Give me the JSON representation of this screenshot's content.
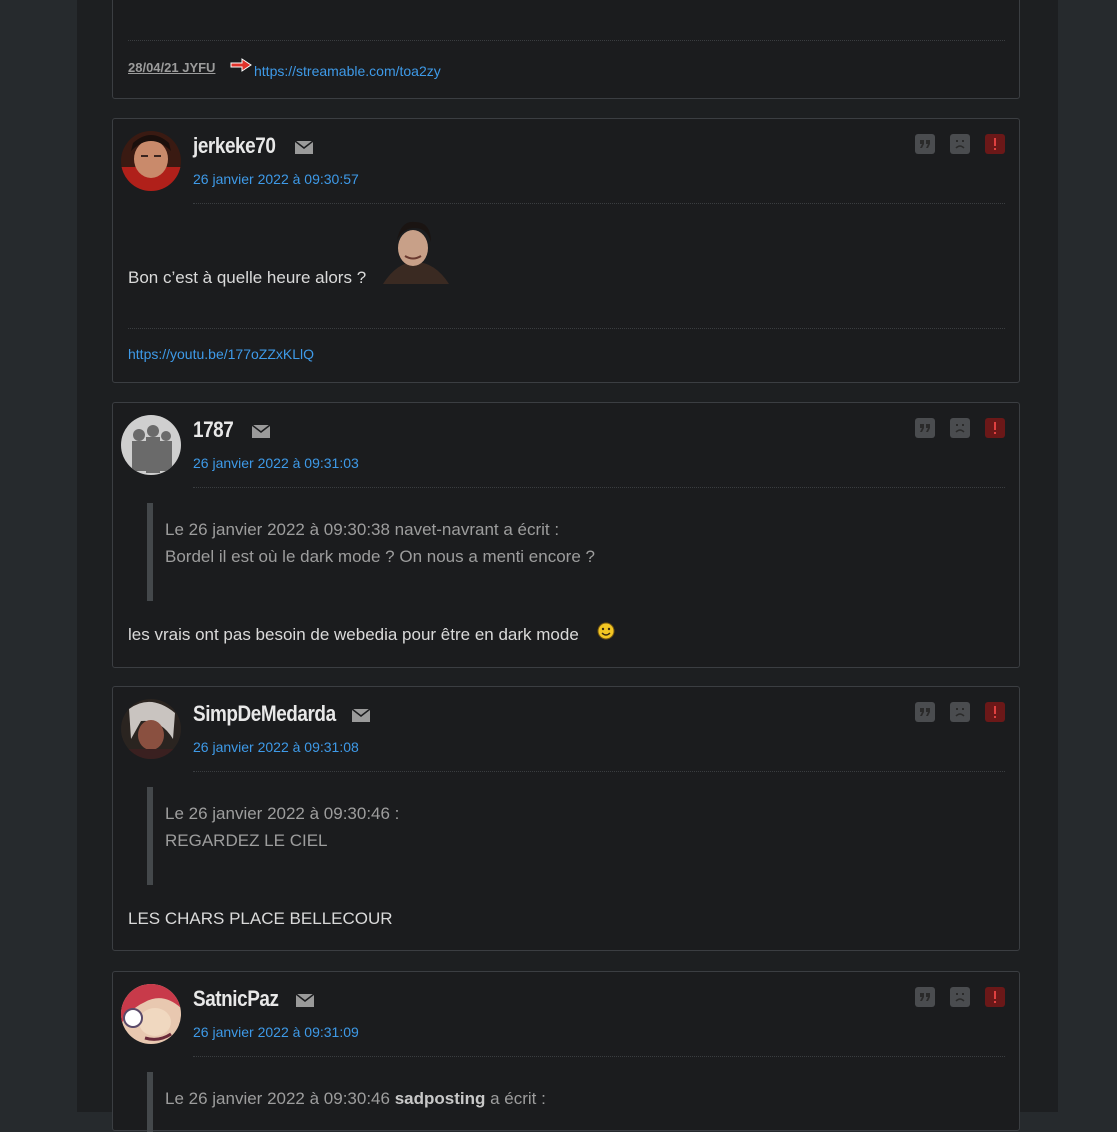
{
  "posts": [
    {
      "signature": {
        "date_label": "28/04/21 JYFU",
        "link": "https://streamable.com/toa2zy"
      }
    },
    {
      "author": "jerkeke70",
      "date": "26 janvier 2022 à 09:30:57",
      "text": "Bon c’est à quelle heure alors ?",
      "signature_link": "https://youtu.be/177oZZxKLlQ"
    },
    {
      "author": "1787",
      "date": "26 janvier 2022 à 09:31:03",
      "quote_header": "Le 26 janvier 2022 à 09:30:38 navet-navrant a écrit :",
      "quote_text": "Bordel il est où le dark mode ? On nous a menti encore ?",
      "text": "les vrais ont pas besoin de webedia pour être en dark mode"
    },
    {
      "author": "SimpDeMedarda",
      "date": "26 janvier 2022 à 09:31:08",
      "quote_header": "Le 26 janvier 2022 à 09:30:46 :",
      "quote_text": "REGARDEZ LE CIEL",
      "text": "LES CHARS PLACE BELLECOUR"
    },
    {
      "author": "SatnicPaz",
      "date": "26 janvier 2022 à 09:31:09",
      "quote_prefix": "Le 26 janvier 2022 à 09:30:46 ",
      "quote_author": "sadposting",
      "quote_suffix": " a écrit :"
    }
  ],
  "icons": {
    "mp": "envelope-icon",
    "quote": "quote-icon",
    "sad": "sad-face-icon",
    "report": "exclamation-icon"
  },
  "colors": {
    "link": "#3e9ae8",
    "report": "#6b1818",
    "background": "#1b1c1e"
  }
}
